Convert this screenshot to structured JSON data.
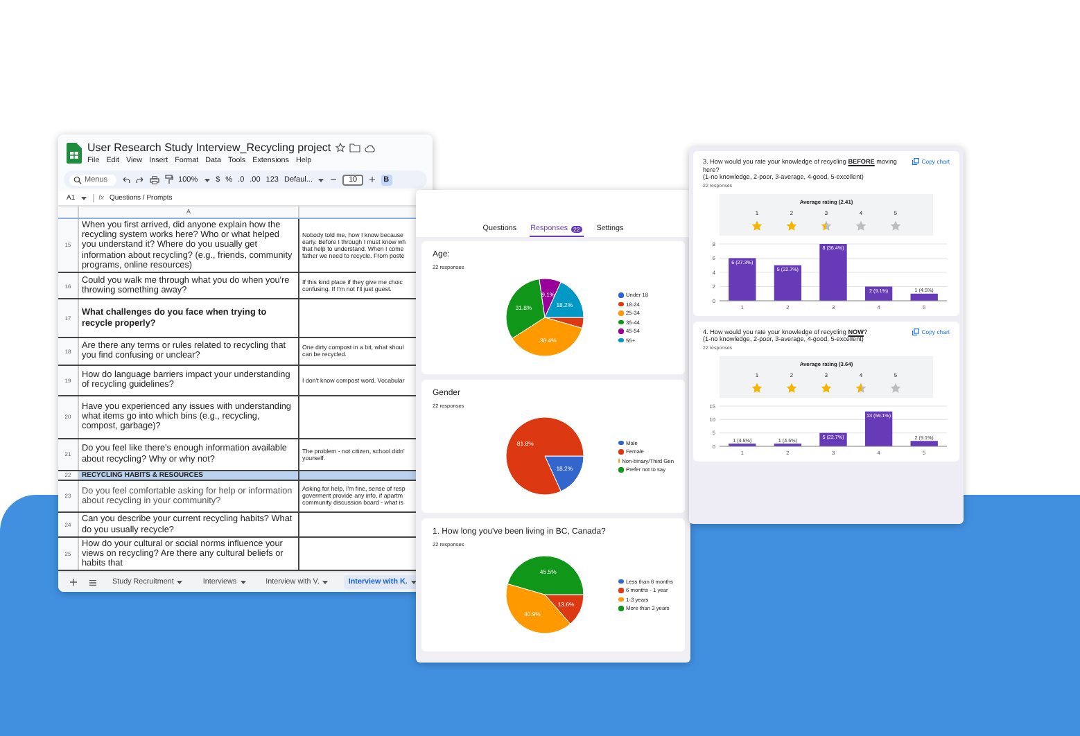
{
  "spreadsheet": {
    "title": "User Research Study Interview_Recycling project",
    "menu": [
      "File",
      "Edit",
      "View",
      "Insert",
      "Format",
      "Data",
      "Tools",
      "Extensions",
      "Help"
    ],
    "toolbar": {
      "search": "Menus",
      "zoom": "100%",
      "currency": "$",
      "percent": "%",
      "decimal_decrease": ".0",
      "decimal_increase": ".00",
      "number_format": "123",
      "font": "Defaul...",
      "font_size": "10",
      "bold": "B"
    },
    "cell_ref": "A1",
    "function_symbol": "fx",
    "formula": "Questions / Prompts",
    "column_header": "A",
    "rows": [
      {
        "number": "15",
        "kind": "question",
        "question": "When you first arrived, did anyone explain how the recycling system works here? Who or what helped you understand it? Where do you usually get information about recycling? (e.g., friends, community programs, online resources)",
        "answer": "Nobody told me, how I know because\nearly. Before I through I must know wh\nthat help to understand. When I come\nfather we need to recycle. From poste"
      },
      {
        "number": "16",
        "kind": "question",
        "question": "Could you walk me through what you do when you're throwing something away?",
        "answer": "If this kind place if they give me choic\nconfusing. If I'm not I'll just guest."
      },
      {
        "number": "17",
        "kind": "question",
        "question": "What challenges do you face when trying to recycle properly?"
      },
      {
        "number": "18",
        "kind": "question",
        "question": "Are there any terms or rules related to recycling that you find confusing or unclear?",
        "answer": "One dirty compost in a bit, what shoul\ncan be recycled."
      },
      {
        "number": "19",
        "kind": "question",
        "question": "How do language barriers impact your understanding of recycling guidelines?",
        "answer": "I don't know compost word. Vocabular"
      },
      {
        "number": "20",
        "kind": "question",
        "question": "Have you experienced any issues with understanding what items go into which bins (e.g., recycling, compost, garbage)?"
      },
      {
        "number": "21",
        "kind": "question",
        "question": "Do you feel like there's enough information available about recycling? Why or why not?",
        "answer": "The problem - not citizen, school didn'\nyourself."
      },
      {
        "number": "22",
        "kind": "section",
        "question": "RECYCLING HABITS & RESOURCES"
      },
      {
        "number": "23",
        "kind": "question",
        "question": "Do you feel comfortable asking for help or information about recycling in your community?",
        "answer": "Asking for help, I'm fine, sense of resp\ngoverment provide any info, if apartm\ncommunity discussion board - what is"
      },
      {
        "number": "24",
        "kind": "question",
        "question": "Can you describe your current recycling habits? What do you usually recycle?"
      },
      {
        "number": "25",
        "kind": "question",
        "question": "How do your cultural or social norms influence your views on recycling? Are there any cultural beliefs or habits that"
      }
    ],
    "sheet_tabs": [
      {
        "label": "Study Recruitment",
        "selected": false
      },
      {
        "label": "Interviews",
        "selected": false
      },
      {
        "label": "Interview with V.",
        "selected": false
      },
      {
        "label": "Interview with K.",
        "selected": true
      }
    ]
  },
  "forms": {
    "tabs": [
      {
        "label": "Questions",
        "selected": false
      },
      {
        "label": "Responses",
        "selected": true,
        "badge": "22"
      },
      {
        "label": "Settings",
        "selected": false
      }
    ],
    "cards": [
      {
        "title": "Age:",
        "responses": "22 responses",
        "chart_data": {
          "type": "pie",
          "categories": [
            "Under 18",
            "18-24",
            "25-34",
            "35-44",
            "45-54",
            "55+"
          ],
          "series": [
            {
              "values": [
                0,
                4.5,
                36.4,
                31.8,
                9.1,
                18.2
              ]
            }
          ],
          "value_labels": [
            null,
            null,
            "36.4%",
            "31.8%",
            "9.1%",
            "18.2%"
          ]
        }
      },
      {
        "title": "Gender",
        "responses": "22 responses",
        "chart_data": {
          "type": "pie",
          "categories": [
            "Male",
            "Female",
            "Non-binary/Third Gen",
            "Prefer not to say"
          ],
          "series": [
            {
              "values": [
                18.2,
                81.8,
                0,
                0
              ]
            }
          ],
          "value_labels": [
            "18.2%",
            "81.8%",
            null,
            null
          ]
        }
      },
      {
        "title": "1. How long you've been living in BC, Canada?",
        "responses": "22 responses",
        "chart_data": {
          "type": "pie",
          "categories": [
            "Less than 6 months",
            "6 months - 1 year",
            "1-3 years",
            "More than 3 years"
          ],
          "series": [
            {
              "values": [
                0,
                13.6,
                40.9,
                45.5
              ]
            }
          ],
          "value_labels": [
            null,
            "13.6%",
            "40.9%",
            "45.5%"
          ]
        }
      }
    ]
  },
  "ratings": {
    "cards": [
      {
        "question": "3. How would you rate your knowledge of recycling **BEFORE** moving here?",
        "scale": "(1-no knowledge, 2-poor, 3-average, 4-good, 5-excellent)",
        "responses": "22 responses",
        "copy": "Copy chart",
        "average": "Average rating (2.41)",
        "star_labels": [
          "1",
          "2",
          "3",
          "4",
          "5"
        ],
        "stars": 2.41,
        "chart_data": {
          "type": "bar",
          "categories": [
            "1",
            "2",
            "3",
            "4",
            "5"
          ],
          "series": [
            {
              "color": "#673ab7",
              "values": [
                6,
                5,
                8,
                2,
                1
              ]
            }
          ],
          "grid": true,
          "ylim": [
            0,
            8
          ],
          "yticks": [
            0,
            2,
            4,
            6,
            8
          ],
          "value_labels": [
            "6 (27.3%)",
            "5 (22.7%)",
            "8 (36.4%)",
            "2 (9.1%)",
            "1 (4.5%)"
          ]
        }
      },
      {
        "question": "4. How would you rate your knowledge of recycling **NOW**?",
        "scale": "(1-no knowledge, 2-poor, 3-average, 4-good, 5-excellent)",
        "responses": "22 responses",
        "copy": "Copy chart",
        "average": "Average rating (3.64)",
        "star_labels": [
          "1",
          "2",
          "3",
          "4",
          "5"
        ],
        "stars": 3.64,
        "chart_data": {
          "type": "bar",
          "categories": [
            "1",
            "2",
            "3",
            "4",
            "5"
          ],
          "series": [
            {
              "color": "#673ab7",
              "values": [
                1,
                1,
                5,
                13,
                2
              ]
            }
          ],
          "grid": true,
          "ylim": [
            0,
            15
          ],
          "yticks": [
            0,
            5,
            10,
            15
          ],
          "value_labels": [
            "1 (4.5%)",
            "1 (4.5%)",
            "5 (22.7%)",
            "13 (59.1%)",
            "2 (9.1%)"
          ]
        }
      }
    ]
  }
}
